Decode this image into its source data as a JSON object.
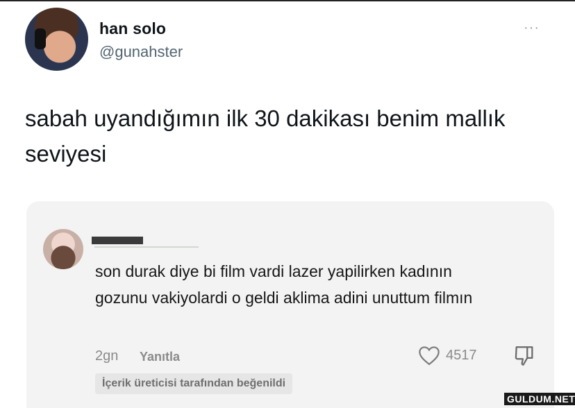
{
  "tweet": {
    "author": {
      "display_name": "han solo",
      "handle": "@gunahster"
    },
    "more_label": "···",
    "text": "sabah uyandığımın ilk 30 dakikası benim mallık seviyesi"
  },
  "comment": {
    "text": "son durak  diye bi film vardi lazer yapilirken kadının gozunu vakiyolardi o geldi aklima adini unuttum filmın",
    "time": "2gn",
    "reply_label": "Yanıtla",
    "like_count": "4517",
    "liked_by_creator": "İçerik üreticisi tarafından beğenildi"
  },
  "watermark": "GULDUM.NET"
}
